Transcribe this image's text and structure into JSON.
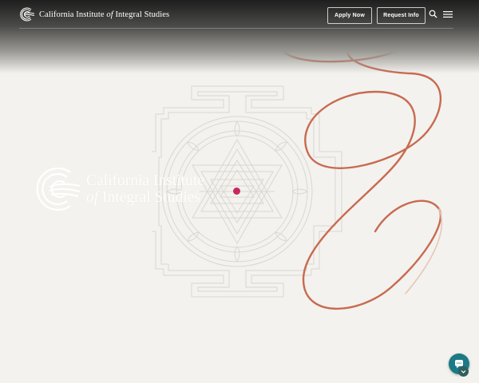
{
  "header": {
    "logo": {
      "line_a": "California Institute",
      "of": "of",
      "line_b": "Integral Studies"
    },
    "apply_label": "Apply Now",
    "request_label": "Request Info",
    "search_icon": "search-icon",
    "menu_icon": "hamburger-menu-icon"
  },
  "hero": {
    "logo": {
      "line1": "California Institute",
      "of": "of",
      "line2": "Integral Studies"
    },
    "ornament": "sri-yantra-illustration"
  },
  "colors": {
    "accent_dot": "#c8285f",
    "swirl_line": "#c86a50",
    "chat_button": "#1b7a86",
    "background": "#f3f2ee"
  },
  "chat": {
    "icon": "chat-bubble-icon"
  }
}
